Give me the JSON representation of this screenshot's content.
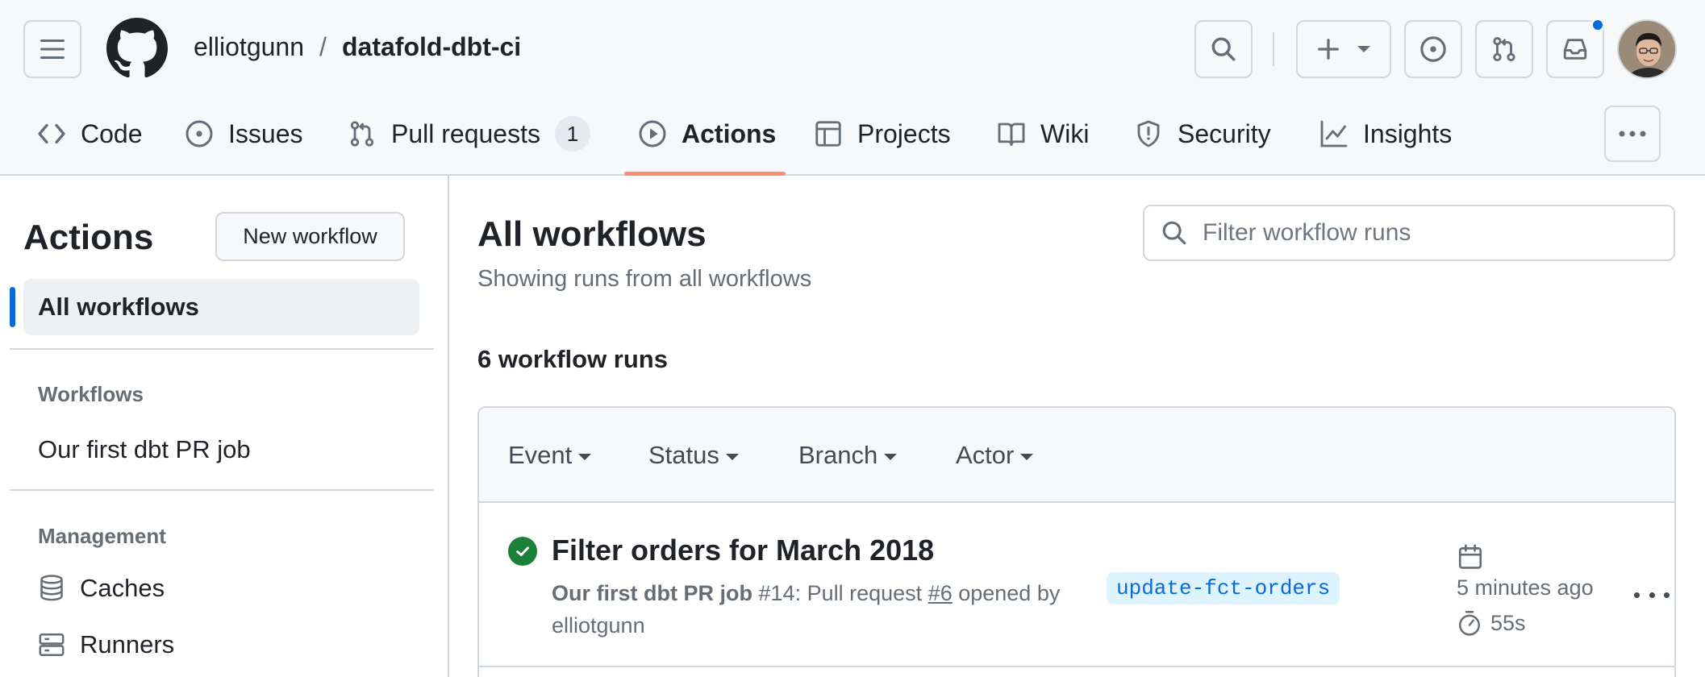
{
  "header": {
    "owner": "elliotgunn",
    "separator": "/",
    "repo": "datafold-dbt-ci"
  },
  "tabs": [
    {
      "label": "Code",
      "icon": "code-icon"
    },
    {
      "label": "Issues",
      "icon": "issue-opened-icon"
    },
    {
      "label": "Pull requests",
      "icon": "git-pull-request-icon",
      "count": "1"
    },
    {
      "label": "Actions",
      "icon": "play-icon",
      "active": true
    },
    {
      "label": "Projects",
      "icon": "table-icon"
    },
    {
      "label": "Wiki",
      "icon": "book-icon"
    },
    {
      "label": "Security",
      "icon": "shield-icon"
    },
    {
      "label": "Insights",
      "icon": "graph-icon"
    }
  ],
  "sidebar": {
    "title": "Actions",
    "new_workflow_label": "New workflow",
    "active_item": "All workflows",
    "workflows_heading": "Workflows",
    "workflows": [
      "Our first dbt PR job"
    ],
    "management_heading": "Management",
    "management_items": [
      {
        "label": "Caches",
        "icon": "database-icon"
      },
      {
        "label": "Runners",
        "icon": "server-icon"
      }
    ]
  },
  "main": {
    "title": "All workflows",
    "subtitle": "Showing runs from all workflows",
    "filter_placeholder": "Filter workflow runs",
    "run_count": "6 workflow runs",
    "filters": [
      "Event",
      "Status",
      "Branch",
      "Actor"
    ]
  },
  "runs": [
    {
      "status": "success",
      "title": "Filter orders for March 2018",
      "workflow": "Our first dbt PR job",
      "run_number": "#14",
      "event_prefix": ": Pull request ",
      "pr_number": "#6",
      "event_suffix": " opened by",
      "actor": "elliotgunn",
      "branch": "update-fct-orders",
      "time_ago": "5 minutes ago",
      "duration": "55s"
    }
  ],
  "colors": {
    "accent_blue": "#0969da",
    "success_green": "#1a7f37",
    "tab_underline": "#fd8c73",
    "border": "#d0d7de",
    "muted_text": "#656d76"
  }
}
